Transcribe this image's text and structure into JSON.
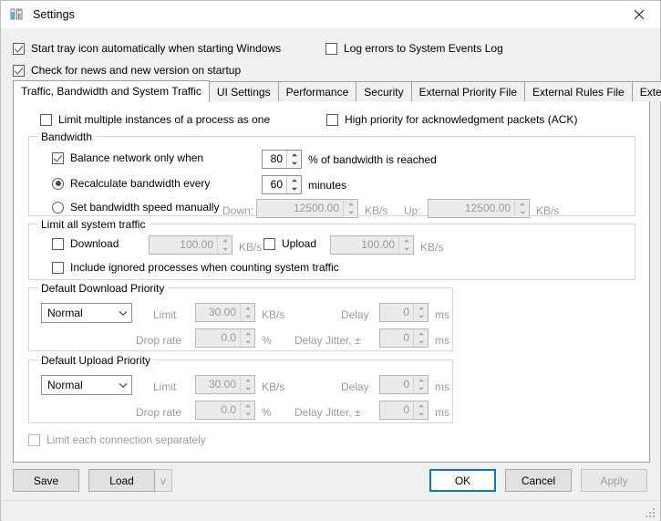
{
  "window": {
    "title": "Settings",
    "icon": "network-meter-icon",
    "close_label": "✕",
    "accent_color": "#0078d7"
  },
  "top_options": [
    {
      "label": "Start tray icon automatically when starting Windows",
      "checked": true,
      "name": "start-tray-icon-checkbox"
    },
    {
      "label": "Check for news and new version on startup",
      "checked": true,
      "name": "check-news-checkbox"
    },
    {
      "label": "Log errors to System Events Log",
      "checked": false,
      "name": "log-errors-checkbox"
    }
  ],
  "tabs": [
    {
      "label": "Traffic, Bandwidth and System Traffic",
      "active": true
    },
    {
      "label": "UI Settings",
      "active": false
    },
    {
      "label": "Performance",
      "active": false
    },
    {
      "label": "Security",
      "active": false
    },
    {
      "label": "External Priority File",
      "active": false
    },
    {
      "label": "External Rules File",
      "active": false
    },
    {
      "label": "External Filters File",
      "active": false
    }
  ],
  "panel": {
    "limit_multiple_instances": {
      "label": "Limit multiple instances of a process as one",
      "checked": false
    },
    "high_priority_ack": {
      "label": "High priority for acknowledgment packets (ACK)",
      "checked": false
    },
    "bandwidth": {
      "group_label": "Bandwidth",
      "balance_network": {
        "label": "Balance network only when",
        "checked": true
      },
      "balance_value": "80",
      "balance_suffix": "% of bandwidth is reached",
      "recalculate": {
        "label": "Recalculate bandwidth every",
        "selected": true
      },
      "recalculate_value": "60",
      "recalculate_suffix": "minutes",
      "manual": {
        "label": "Set bandwidth speed manually",
        "selected": false
      },
      "down_label": "Down:",
      "down_value": "12500.00",
      "down_unit": "KB/s",
      "up_label": "Up:",
      "up_value": "12500.00",
      "up_unit": "KB/s"
    },
    "system_traffic": {
      "group_label": "Limit all system traffic",
      "download": {
        "label": "Download",
        "checked": false
      },
      "download_value": "100.00",
      "download_unit": "KB/s",
      "upload": {
        "label": "Upload",
        "checked": false
      },
      "upload_value": "100.00",
      "upload_unit": "KB/s",
      "include_ignored": {
        "label": "Include ignored processes when counting system traffic",
        "checked": false
      }
    },
    "default_download_priority": {
      "group_label": "Default Download Priority",
      "priority_value": "Normal",
      "limit_label": "Limit",
      "limit_value": "30.00",
      "limit_unit": "KB/s",
      "delay_label": "Delay",
      "delay_value": "0",
      "delay_unit": "ms",
      "drop_rate_label": "Drop rate",
      "drop_rate_value": "0.0",
      "drop_rate_unit": "%",
      "delay_jitter_label": "Delay Jitter, ±",
      "delay_jitter_value": "0",
      "delay_jitter_unit": "ms"
    },
    "default_upload_priority": {
      "group_label": "Default Upload Priority",
      "priority_value": "Normal",
      "limit_label": "Limit",
      "limit_value": "30.00",
      "limit_unit": "KB/s",
      "delay_label": "Delay",
      "delay_value": "0",
      "delay_unit": "ms",
      "drop_rate_label": "Drop rate",
      "drop_rate_value": "0.0",
      "drop_rate_unit": "%",
      "delay_jitter_label": "Delay Jitter, ±",
      "delay_jitter_value": "0",
      "delay_jitter_unit": "ms"
    },
    "limit_each_connection": {
      "label": "Limit each connection separately",
      "checked": false
    }
  },
  "buttons": {
    "save": "Save",
    "load": "Load",
    "load_split": "v",
    "ok": "OK",
    "cancel": "Cancel",
    "apply": "Apply"
  }
}
